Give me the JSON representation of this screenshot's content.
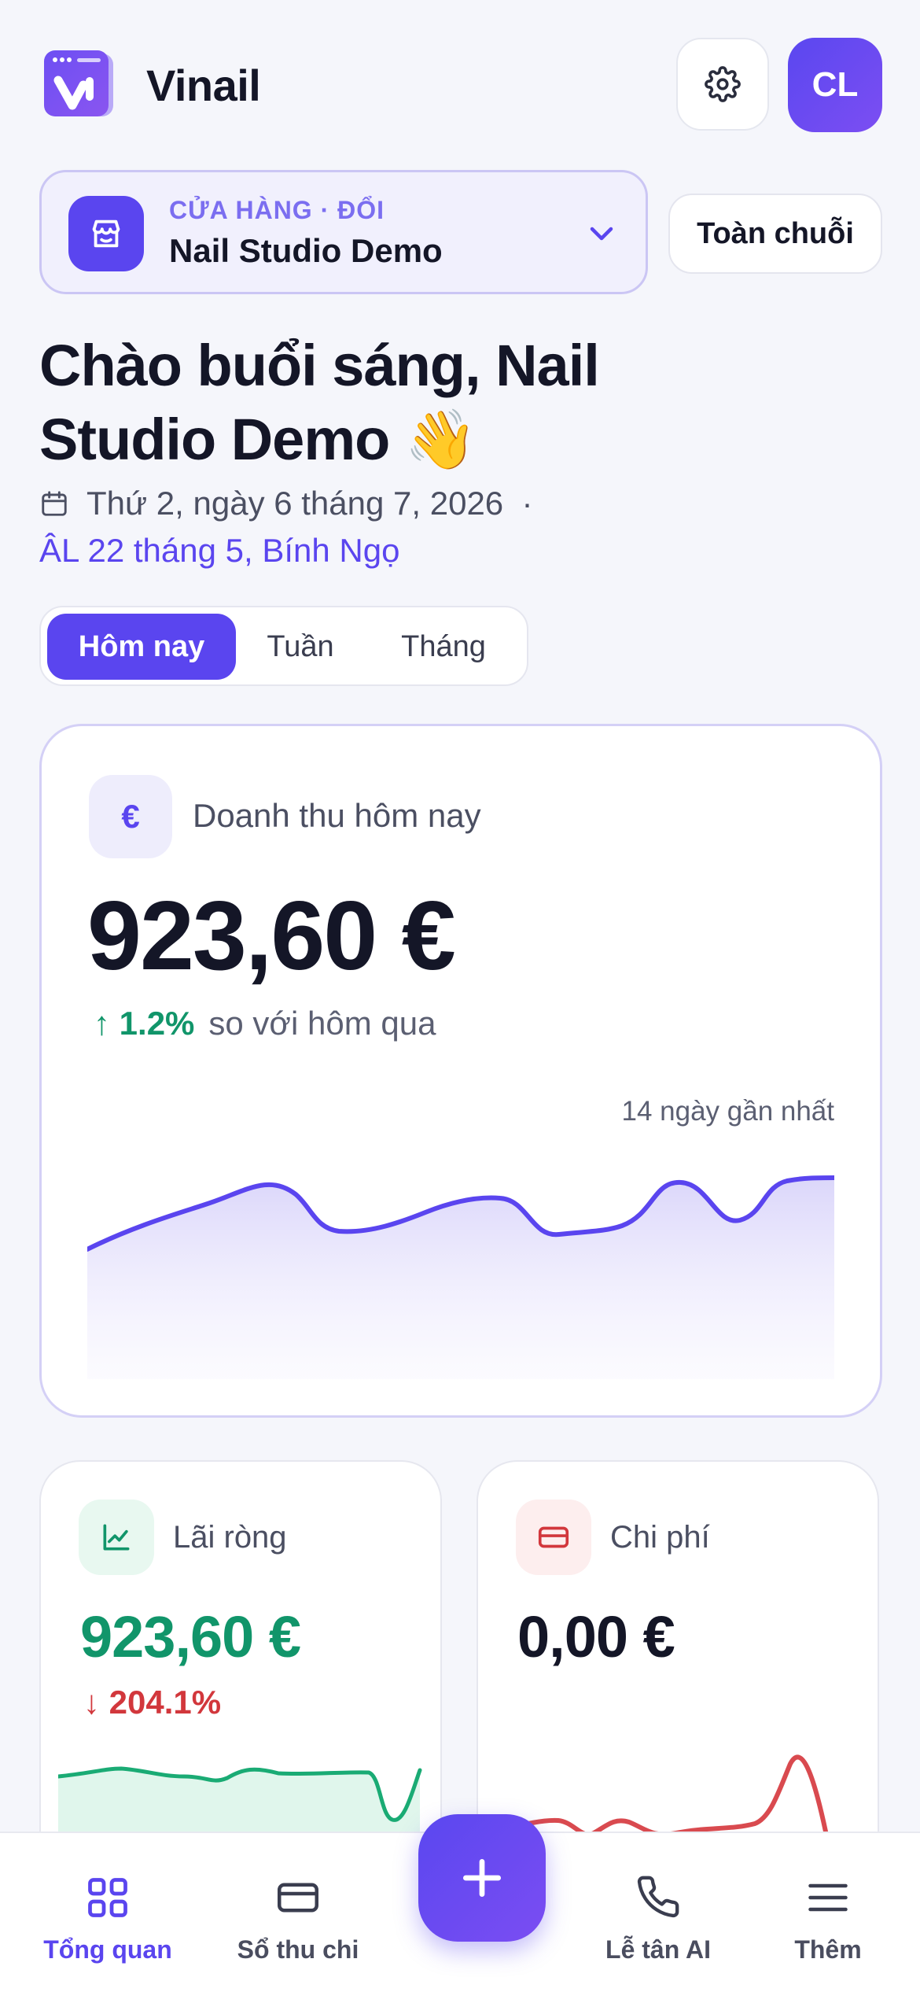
{
  "app": {
    "name": "Vinail",
    "avatar_initials": "CL"
  },
  "store": {
    "kicker": "CỬA HÀNG · ĐỔI",
    "name": "Nail Studio Demo",
    "chain_button": "Toàn chuỗi"
  },
  "greeting": {
    "title": "Chào buổi sáng, Nail Studio Demo 👋",
    "date": "Thứ 2, ngày 6 tháng 7, 2026  ·",
    "lunar": "ÂL 22 tháng 5, Bính Ngọ"
  },
  "periods": {
    "today": "Hôm nay",
    "week": "Tuần",
    "month": "Tháng"
  },
  "revenue": {
    "label": "Doanh thu hôm nay",
    "value": "923,60 €",
    "delta": "↑ 1.2%",
    "compare": "so với hôm qua",
    "period": "14 ngày gần nhất",
    "icon": "euro-icon"
  },
  "profit": {
    "label": "Lãi ròng",
    "value": "923,60 €",
    "delta": "↓ 204.1%"
  },
  "expense": {
    "label": "Chi phí",
    "value": "0,00 €"
  },
  "nav": {
    "overview": "Tổng quan",
    "ledger": "Sổ thu chi",
    "reception": "Lễ tân AI",
    "more": "Thêm"
  },
  "colors": {
    "accent": "#5a45ef",
    "positive": "#11956a",
    "negative": "#d2373c",
    "background": "#f5f6fb"
  }
}
